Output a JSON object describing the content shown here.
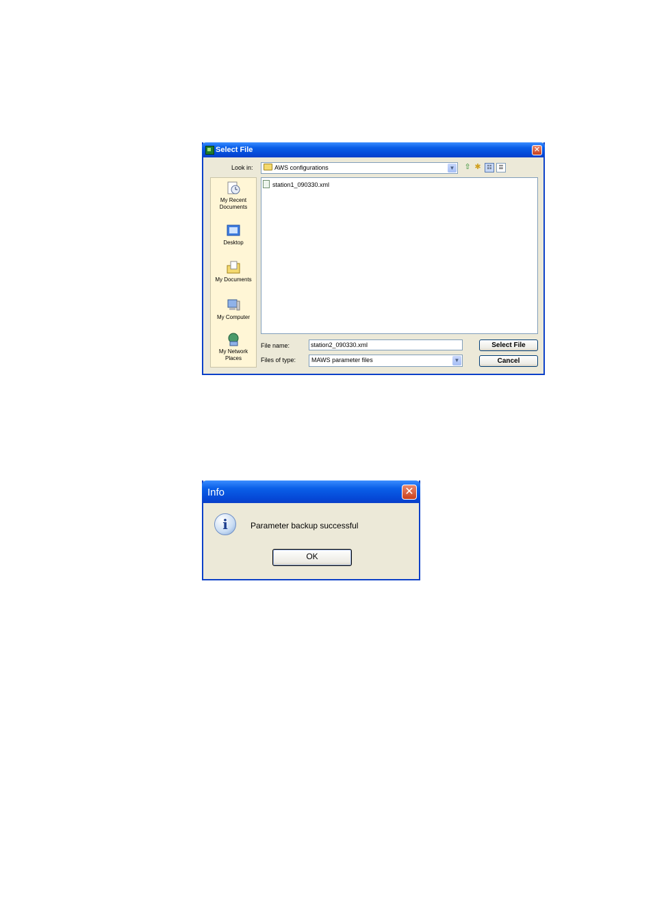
{
  "select_dialog": {
    "title": "Select File",
    "look_in_label": "Look in:",
    "look_in_value": "AWS configurations",
    "places": [
      {
        "label": "My Recent Documents",
        "icon": "recent-documents-icon"
      },
      {
        "label": "Desktop",
        "icon": "desktop-icon"
      },
      {
        "label": "My Documents",
        "icon": "my-documents-icon"
      },
      {
        "label": "My Computer",
        "icon": "my-computer-icon"
      },
      {
        "label": "My Network Places",
        "icon": "network-places-icon"
      }
    ],
    "files": [
      "station1_090330.xml"
    ],
    "file_name_label": "File name:",
    "file_name_value": "station2_090330.xml",
    "files_of_type_label": "Files of type:",
    "files_of_type_value": "MAWS parameter files",
    "select_button": "Select File",
    "cancel_button": "Cancel"
  },
  "info_dialog": {
    "title": "Info",
    "message": "Parameter backup successful",
    "ok_button": "OK"
  },
  "colors": {
    "title_bar": "#0548d6",
    "dialog_bg": "#ece9d8",
    "close_button": "#c8401c"
  }
}
